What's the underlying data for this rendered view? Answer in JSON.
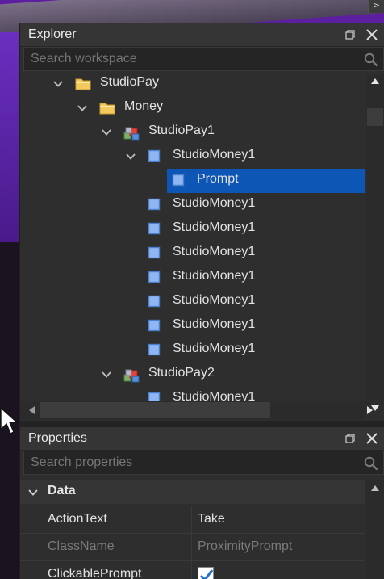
{
  "explorer": {
    "title": "Explorer",
    "search_placeholder": "Search workspace",
    "tree": [
      {
        "label": "StudioPay",
        "icon": "folder-icon",
        "expanded": true
      },
      {
        "label": "Money",
        "icon": "folder-icon",
        "expanded": true
      },
      {
        "label": "StudioPay1",
        "icon": "model-icon",
        "expanded": true
      },
      {
        "label": "StudioMoney1",
        "icon": "part-icon",
        "expanded": true
      },
      {
        "label": "Prompt",
        "icon": "part-icon",
        "selected": true
      },
      {
        "label": "StudioMoney1",
        "icon": "part-icon"
      },
      {
        "label": "StudioMoney1",
        "icon": "part-icon"
      },
      {
        "label": "StudioMoney1",
        "icon": "part-icon"
      },
      {
        "label": "StudioMoney1",
        "icon": "part-icon"
      },
      {
        "label": "StudioMoney1",
        "icon": "part-icon"
      },
      {
        "label": "StudioMoney1",
        "icon": "part-icon"
      },
      {
        "label": "StudioMoney1",
        "icon": "part-icon"
      },
      {
        "label": "StudioPay2",
        "icon": "model-icon",
        "expanded": true
      },
      {
        "label": "StudioMoney1",
        "icon": "part-icon"
      }
    ]
  },
  "properties": {
    "title": "Properties",
    "search_placeholder": "Search properties",
    "category": "Data",
    "rows": [
      {
        "name": "ActionText",
        "value": "Take"
      },
      {
        "name": "ClassName",
        "value": "ProximityPrompt",
        "disabled": true
      },
      {
        "name": "ClickablePrompt",
        "value": "",
        "checked": true
      }
    ]
  },
  "colors": {
    "selection": "#0e56b5",
    "panel_bg": "#2e2e2e",
    "header_bg": "#353535",
    "viewport_purple": "#5b1fa0"
  }
}
